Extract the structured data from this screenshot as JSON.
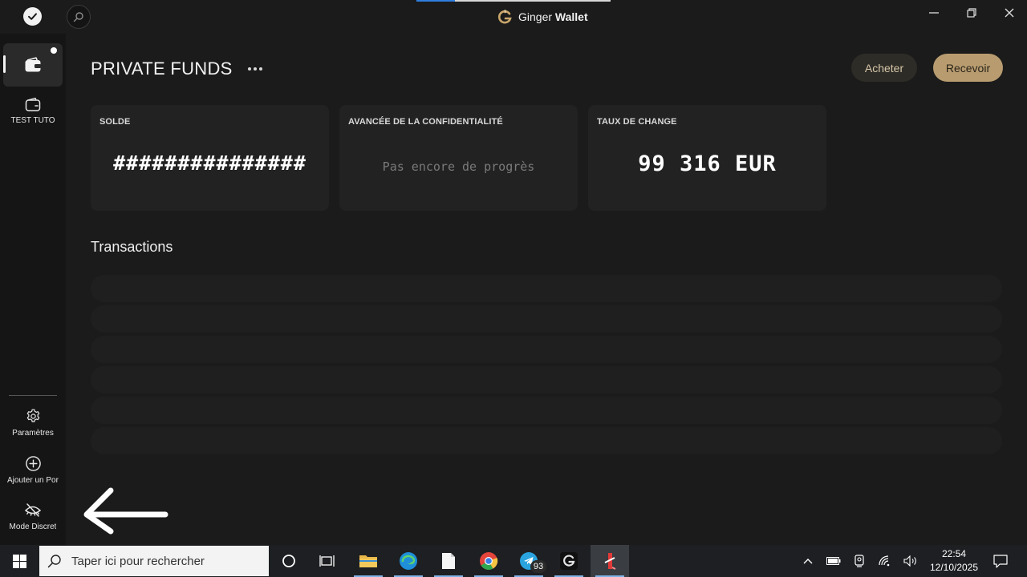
{
  "app": {
    "brand_prefix": "Ginger",
    "brand_suffix": "Wallet"
  },
  "sidebar": {
    "items": [
      {
        "label": "TEST TUTO"
      },
      {
        "label": "Paramètres"
      },
      {
        "label": "Ajouter un Portefeuille"
      },
      {
        "label": "Mode Discret"
      }
    ]
  },
  "header": {
    "title": "PRIVATE FUNDS",
    "buy_label": "Acheter",
    "receive_label": "Recevoir"
  },
  "cards": {
    "balance": {
      "title": "SOLDE",
      "value": "###############"
    },
    "privacy": {
      "title": "AVANCÉE DE LA CONFIDENTIALITÉ",
      "value": "Pas encore de progrès"
    },
    "rate": {
      "title": "TAUX DE CHANGE",
      "value": "99 316 EUR"
    }
  },
  "transactions": {
    "title": "Transactions"
  },
  "taskbar": {
    "search_placeholder": "Taper ici pour rechercher",
    "telegram_badge": "93",
    "time": "22:54",
    "date": "12/10/2025"
  },
  "colors": {
    "background": "#1b1b1b",
    "sidebar": "#151515",
    "card": "#222222",
    "accent_gold": "#b89c70",
    "button_dark": "#2e2c27"
  }
}
